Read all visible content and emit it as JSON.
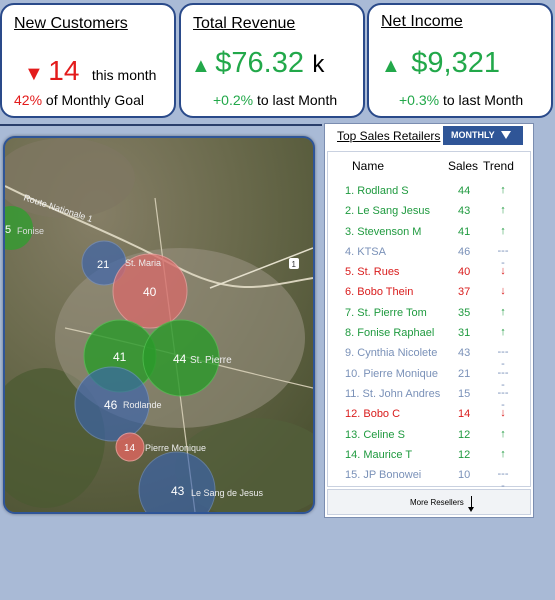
{
  "cards": {
    "new_customers": {
      "title": "New Customers",
      "arrow": "▼",
      "value": "14",
      "suffix": "this month",
      "goal_pct": "42%",
      "goal_text": "of Monthly Goal"
    },
    "total_revenue": {
      "title": "Total Revenue",
      "arrow": "▲",
      "value": "$76.32",
      "unit": "k",
      "change": "+0.2%",
      "change_text": "to last Month"
    },
    "net_income": {
      "title": "Net Income",
      "arrow": "▲",
      "value": "$9,321",
      "change": "+0.3%",
      "change_text": "to last Month"
    }
  },
  "map": {
    "road_label": "Route Nationale 1",
    "place_labels": [
      "Fonise",
      "St. Maria",
      "St. Pierre",
      "Rodlande",
      "Pierre Monique",
      "Le Sang de Jesus"
    ],
    "road_badge": "1",
    "bubbles": [
      {
        "value": "5",
        "color": "green"
      },
      {
        "value": "21",
        "color": "blue"
      },
      {
        "value": "40",
        "color": "red"
      },
      {
        "value": "41",
        "color": "green"
      },
      {
        "value": "44",
        "color": "green"
      },
      {
        "value": "46",
        "color": "blue"
      },
      {
        "value": "14",
        "color": "red"
      },
      {
        "value": "43",
        "color": "blue"
      }
    ]
  },
  "retailers": {
    "title": "Top Sales Retailers",
    "period": "MONTHLY",
    "columns": {
      "name": "Name",
      "sales": "Sales",
      "trend": "Trend"
    },
    "rows": [
      {
        "rank": "1.",
        "name": "Rodland S",
        "sales": "44",
        "trend": "↑",
        "status": "green"
      },
      {
        "rank": "2.",
        "name": "Le Sang Jesus",
        "sales": "43",
        "trend": "↑",
        "status": "green"
      },
      {
        "rank": "3.",
        "name": "Stevenson M",
        "sales": "41",
        "trend": "↑",
        "status": "green"
      },
      {
        "rank": "4.",
        "name": "KTSA",
        "sales": "46",
        "trend": "----",
        "status": "gray"
      },
      {
        "rank": "5.",
        "name": "St. Rues",
        "sales": "40",
        "trend": "↓",
        "status": "red"
      },
      {
        "rank": "6.",
        "name": "Bobo Thein",
        "sales": "37",
        "trend": "↓",
        "status": "red"
      },
      {
        "rank": "7.",
        "name": "St. Pierre Tom",
        "sales": "35",
        "trend": "↑",
        "status": "green"
      },
      {
        "rank": "8.",
        "name": "Fonise Raphael",
        "sales": "31",
        "trend": "↑",
        "status": "green"
      },
      {
        "rank": "9.",
        "name": "Cynthia Nicolete",
        "sales": "43",
        "trend": "----",
        "status": "gray"
      },
      {
        "rank": "10.",
        "name": "Pierre Monique",
        "sales": "21",
        "trend": "----",
        "status": "gray"
      },
      {
        "rank": "11.",
        "name": "St. John Andres",
        "sales": "15",
        "trend": "----",
        "status": "gray"
      },
      {
        "rank": "12.",
        "name": "Bobo C",
        "sales": "14",
        "trend": "↓",
        "status": "red"
      },
      {
        "rank": "13.",
        "name": "Celine S",
        "sales": "12",
        "trend": "↑",
        "status": "green"
      },
      {
        "rank": "14.",
        "name": "Maurice T",
        "sales": "12",
        "trend": "↑",
        "status": "green"
      },
      {
        "rank": "15.",
        "name": "JP Bonowei",
        "sales": "10",
        "trend": "----",
        "status": "gray"
      }
    ],
    "more_label": "More Resellers"
  }
}
